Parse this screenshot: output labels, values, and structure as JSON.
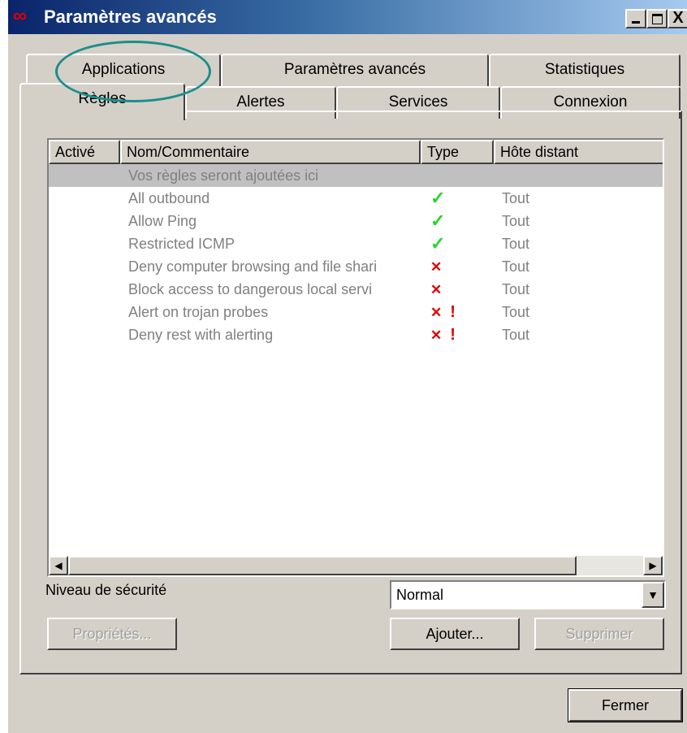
{
  "window": {
    "title": "Paramètres avancés",
    "icon": "infinity-icon",
    "controls": [
      "minimize-icon",
      "maximize-icon",
      "close-icon"
    ],
    "close_glyph": "X"
  },
  "tabs_back_row": [
    {
      "label": "Applications"
    },
    {
      "label": "Paramètres avancés"
    },
    {
      "label": "Statistiques"
    }
  ],
  "tabs_front_row": [
    {
      "label": "Règles",
      "active": true
    },
    {
      "label": "Alertes"
    },
    {
      "label": "Services"
    },
    {
      "label": "Connexion"
    }
  ],
  "table": {
    "columns": [
      "Activé",
      "Nom/Commentaire",
      "Type",
      "Hôte distant"
    ],
    "rows": [
      {
        "active": "",
        "name": "Vos règles seront ajoutées ici",
        "type": "",
        "host": "",
        "selected": true
      },
      {
        "active": "",
        "name": "All outbound",
        "type": "allow",
        "host": "Tout"
      },
      {
        "active": "",
        "name": "Allow Ping",
        "type": "allow",
        "host": "Tout"
      },
      {
        "active": "",
        "name": "Restricted ICMP",
        "type": "allow",
        "host": "Tout"
      },
      {
        "active": "",
        "name": "Deny computer browsing and file shari",
        "type": "deny",
        "host": "Tout"
      },
      {
        "active": "",
        "name": "Block access to dangerous local servi",
        "type": "deny",
        "host": "Tout"
      },
      {
        "active": "",
        "name": "Alert on trojan probes",
        "type": "deny-alert",
        "host": "Tout"
      },
      {
        "active": "",
        "name": "Deny rest with alerting",
        "type": "deny-alert",
        "host": "Tout"
      }
    ],
    "type_glyphs": {
      "allow": "✓",
      "deny": "✕",
      "alert": "!"
    }
  },
  "security": {
    "label": "Niveau de sécurité",
    "selected": "Normal"
  },
  "buttons": {
    "properties": "Propriétés...",
    "add": "Ajouter...",
    "delete": "Supprimer",
    "close": "Fermer"
  },
  "colors": {
    "allow": "#2ad42a",
    "deny": "#e00000",
    "annotation": "#1a8f8a"
  }
}
